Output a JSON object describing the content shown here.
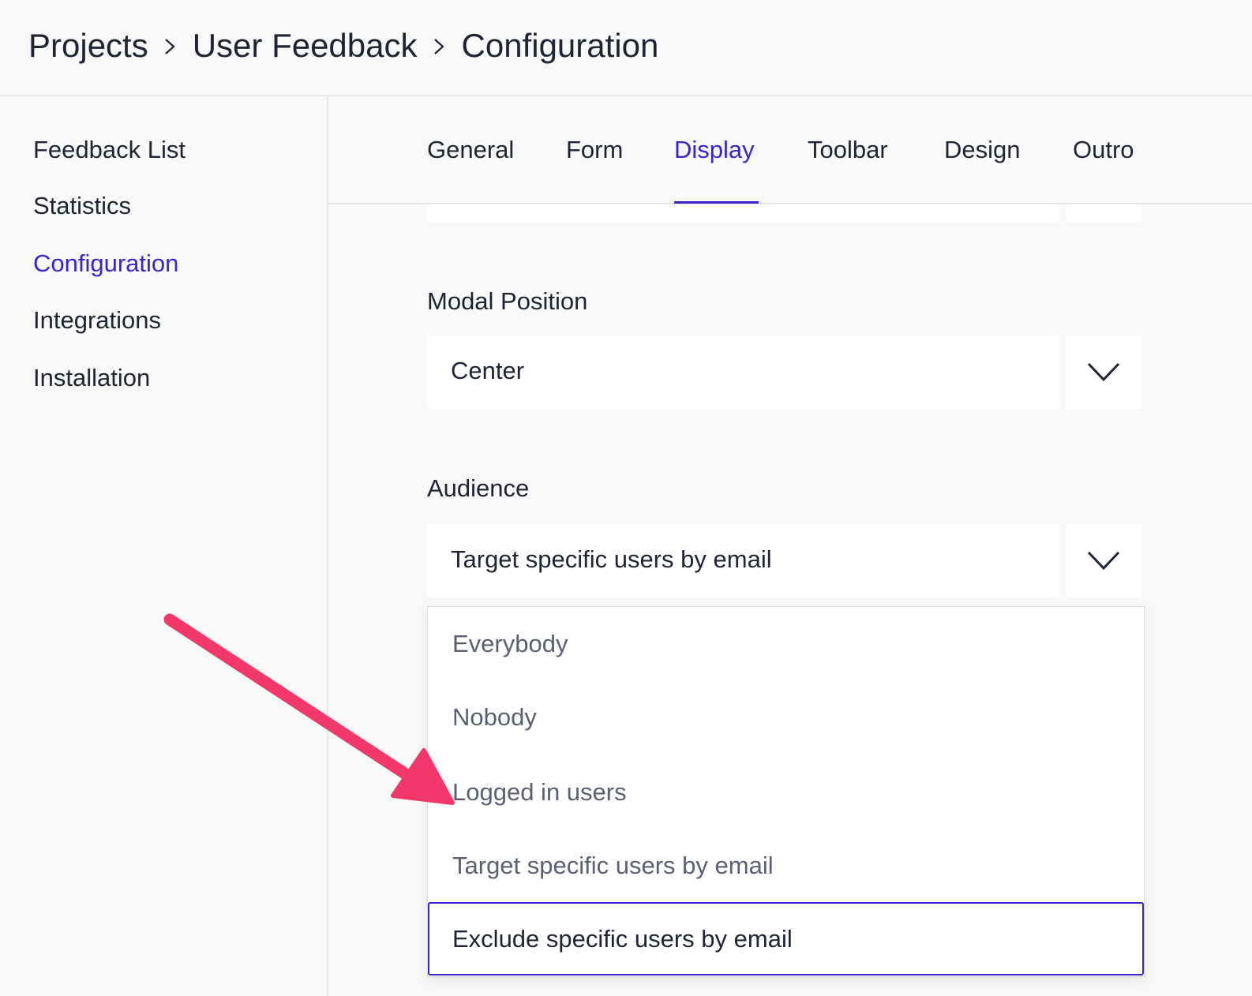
{
  "breadcrumb": {
    "items": [
      "Projects",
      "User Feedback",
      "Configuration"
    ]
  },
  "sidebar": {
    "items": [
      {
        "label": "Feedback List"
      },
      {
        "label": "Statistics"
      },
      {
        "label": "Configuration"
      },
      {
        "label": "Integrations"
      },
      {
        "label": "Installation"
      }
    ],
    "active": "Configuration"
  },
  "tabs": {
    "items": [
      {
        "label": "General"
      },
      {
        "label": "Form"
      },
      {
        "label": "Display"
      },
      {
        "label": "Toolbar"
      },
      {
        "label": "Design"
      },
      {
        "label": "Outro"
      }
    ],
    "active": "Display"
  },
  "modal_position": {
    "label": "Modal Position",
    "value": "Center"
  },
  "audience": {
    "label": "Audience",
    "value": "Target specific users by email",
    "options": [
      {
        "label": "Everybody"
      },
      {
        "label": "Nobody"
      },
      {
        "label": "Logged in users"
      },
      {
        "label": "Target specific users by email"
      },
      {
        "label": "Exclude specific users by email"
      }
    ],
    "highlighted_option": "Exclude specific users by email"
  },
  "colors": {
    "accent": "#3b22c9",
    "annotation_arrow": "#f2386b",
    "text": "#1f2433",
    "muted_text": "#5b6070",
    "background": "#f8f8f8"
  },
  "icons": {
    "breadcrumb_separator": "chevron-right-icon",
    "select_toggle": "chevron-down-icon",
    "annotation": "arrow-icon"
  }
}
